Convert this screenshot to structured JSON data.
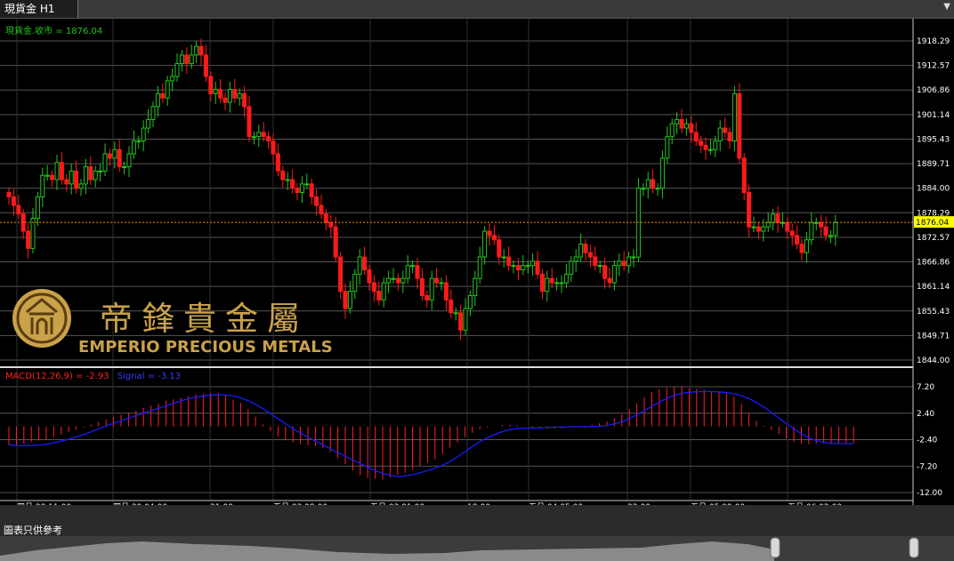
{
  "window": {
    "tab_title": "現貨金 H1"
  },
  "icons": {
    "menu": "dropdown-arrow-icon",
    "logo": "emperio-seal-logo"
  },
  "colors": {
    "background": "#000000",
    "grid": "#555555",
    "up": "#22c51e",
    "down": "#ff1a1a",
    "axis_text": "#ffffff",
    "time_text": "#ffff66",
    "price_line": "#ff8c00",
    "price_label_bg": "#ffff00",
    "macd_hist": "#ff2020",
    "signal": "#1a1aff",
    "gold": "#c9a24a"
  },
  "price_panel": {
    "legend": "現貨金.收市 = 1876.04",
    "current_price": "1876.04",
    "y_ticks": [
      "1918.29",
      "1912.57",
      "1906.86",
      "1901.14",
      "1895.43",
      "1889.71",
      "1884.00",
      "1878.29",
      "1872.57",
      "1866.86",
      "1861.14",
      "1855.43",
      "1849.71",
      "1844.00"
    ]
  },
  "macd_panel": {
    "legend_macd": "MACD(12,26,9) = -2.93",
    "legend_signal": "Signal = -3.13",
    "y_ticks": [
      "7.20",
      "2.40",
      "-2.40",
      "-7.20",
      "-12.00"
    ]
  },
  "time_axis": [
    "四月 28 11:00",
    "四月 29 04:00",
    "21:00",
    "五月 02 08:00",
    "五月 03 01:00",
    "18:00",
    "五月 04 05:00",
    "22:00",
    "五月 05 09:00",
    "五月 06 02:00"
  ],
  "watermark": {
    "chinese": "帝鋒貴金屬",
    "english": "EMPERIO PRECIOUS METALS"
  },
  "footer_note": "圖表只供參考",
  "chart_data": [
    {
      "type": "candlestick",
      "title": "現貨金.收市 = 1876.04",
      "last_close": 1876.04,
      "ylim": [
        1844.0,
        1921.0
      ],
      "closes": [
        1882,
        1880,
        1878,
        1874,
        1870,
        1877,
        1882,
        1887,
        1887,
        1886,
        1890,
        1886,
        1885,
        1888,
        1884,
        1885,
        1889,
        1886,
        1888,
        1888,
        1892,
        1891,
        1893,
        1889,
        1889,
        1892,
        1895,
        1895,
        1898,
        1900,
        1903,
        1906,
        1905,
        1909,
        1910,
        1913,
        1915,
        1913,
        1915,
        1917,
        1915,
        1910,
        1906,
        1907,
        1905,
        1904,
        1907,
        1905,
        1906,
        1903,
        1896,
        1896,
        1897,
        1896,
        1895,
        1892,
        1888,
        1886,
        1886,
        1884,
        1883,
        1885,
        1885,
        1882,
        1880,
        1878,
        1876,
        1875,
        1868,
        1860,
        1856,
        1860,
        1864,
        1868,
        1865,
        1862,
        1860,
        1858,
        1862,
        1863,
        1863,
        1862,
        1863,
        1866,
        1866,
        1863,
        1859,
        1858,
        1863,
        1862,
        1862,
        1858,
        1855,
        1855,
        1851,
        1856,
        1859,
        1863,
        1868,
        1874,
        1873,
        1872,
        1868,
        1868,
        1866,
        1866,
        1865,
        1866,
        1866,
        1867,
        1864,
        1860,
        1863,
        1862,
        1862,
        1862,
        1864,
        1867,
        1868,
        1871,
        1869,
        1868,
        1866,
        1866,
        1863,
        1862,
        1866,
        1867,
        1866,
        1868,
        1868,
        1884,
        1884,
        1886,
        1884,
        1884,
        1891,
        1896,
        1899,
        1900,
        1898,
        1899,
        1897,
        1895,
        1894,
        1893,
        1893,
        1895,
        1898,
        1897,
        1895,
        1906,
        1891,
        1883,
        1875,
        1875,
        1874,
        1875,
        1876,
        1878,
        1876,
        1876,
        1874,
        1873,
        1871,
        1869,
        1872,
        1876,
        1876,
        1875,
        1873,
        1873,
        1876
      ],
      "ohlc_note": "hourly candles, red = down, green = up"
    },
    {
      "type": "bar+line",
      "title": "MACD(12,26,9) = -2.93",
      "ylim": [
        -12.0,
        10.0
      ],
      "series": [
        {
          "name": "MACD(12,26,9)",
          "values": [
            -3.28,
            -3.49,
            -3.14,
            -2.81,
            -2.55,
            -2.3,
            -1.89,
            -1.47,
            -1.04,
            -0.6,
            -0.15,
            0.36,
            0.79,
            1.25,
            1.74,
            2.13,
            2.51,
            2.82,
            3.35,
            3.81,
            4.14,
            4.64,
            4.91,
            5.21,
            5.52,
            5.76,
            5.86,
            6.0,
            6.0,
            5.58,
            4.85,
            4.22,
            3.14,
            1.74,
            0.34,
            -0.84,
            -1.82,
            -2.57,
            -2.9,
            -3.25,
            -3.39,
            -3.54,
            -3.9,
            -4.66,
            -5.76,
            -6.88,
            -7.99,
            -8.86,
            -9.38,
            -9.54,
            -9.68,
            -9.25,
            -8.79,
            -8.4,
            -7.84,
            -7.16,
            -6.59,
            -5.96,
            -5.01,
            -3.83,
            -2.89,
            -1.95,
            -1.16,
            -0.49,
            -0.15,
            0.04,
            0.26,
            0.28,
            0.23,
            -0.05,
            -0.21,
            -0.31,
            -0.36,
            -0.43,
            -0.33,
            -0.21,
            -0.09,
            0.13,
            0.34,
            0.57,
            0.93,
            1.44,
            2.17,
            3.11,
            4.17,
            5.26,
            6.23,
            6.76,
            7.01,
            7.21,
            7.21,
            6.97,
            6.84,
            6.7,
            6.43,
            6.15,
            5.94,
            5.39,
            4.09,
            2.4,
            1.03,
            0.15,
            -0.65,
            -1.4,
            -2.19,
            -2.83,
            -3.12,
            -3.2,
            -3.1,
            -3.11,
            -3.07,
            -2.98,
            -2.97,
            -2.95
          ]
        },
        {
          "name": "Signal",
          "values": [
            -3.33,
            -3.46,
            -3.5,
            -3.46,
            -3.35,
            -3.14,
            -2.84,
            -2.51,
            -2.11,
            -1.63,
            -1.14,
            -0.61,
            -0.01,
            0.5,
            0.99,
            1.49,
            1.97,
            2.45,
            2.93,
            3.41,
            3.88,
            4.34,
            4.83,
            5.18,
            5.45,
            5.62,
            5.71,
            5.72,
            5.59,
            5.25,
            4.69,
            3.98,
            3.12,
            2.17,
            1.17,
            0.22,
            -0.72,
            -1.55,
            -2.3,
            -3.04,
            -3.8,
            -4.55,
            -5.25,
            -5.98,
            -6.68,
            -7.38,
            -8.01,
            -8.56,
            -8.94,
            -9.09,
            -8.94,
            -8.65,
            -8.25,
            -7.8,
            -7.28,
            -6.64,
            -5.8,
            -4.82,
            -3.81,
            -2.85,
            -2.07,
            -1.43,
            -0.92,
            -0.56,
            -0.35,
            -0.3,
            -0.27,
            -0.23,
            -0.17,
            -0.12,
            -0.09,
            -0.06,
            -0.06,
            -0.06,
            -0.02,
            0.16,
            0.46,
            0.89,
            1.52,
            2.28,
            3.08,
            3.91,
            4.7,
            5.37,
            5.87,
            6.14,
            6.27,
            6.33,
            6.33,
            6.27,
            6.15,
            5.93,
            5.55,
            4.96,
            4.18,
            3.26,
            2.21,
            1.11,
            0.06,
            -0.92,
            -1.77,
            -2.43,
            -2.81,
            -3.04,
            -3.13,
            -3.13,
            -3.13
          ]
        }
      ]
    }
  ]
}
